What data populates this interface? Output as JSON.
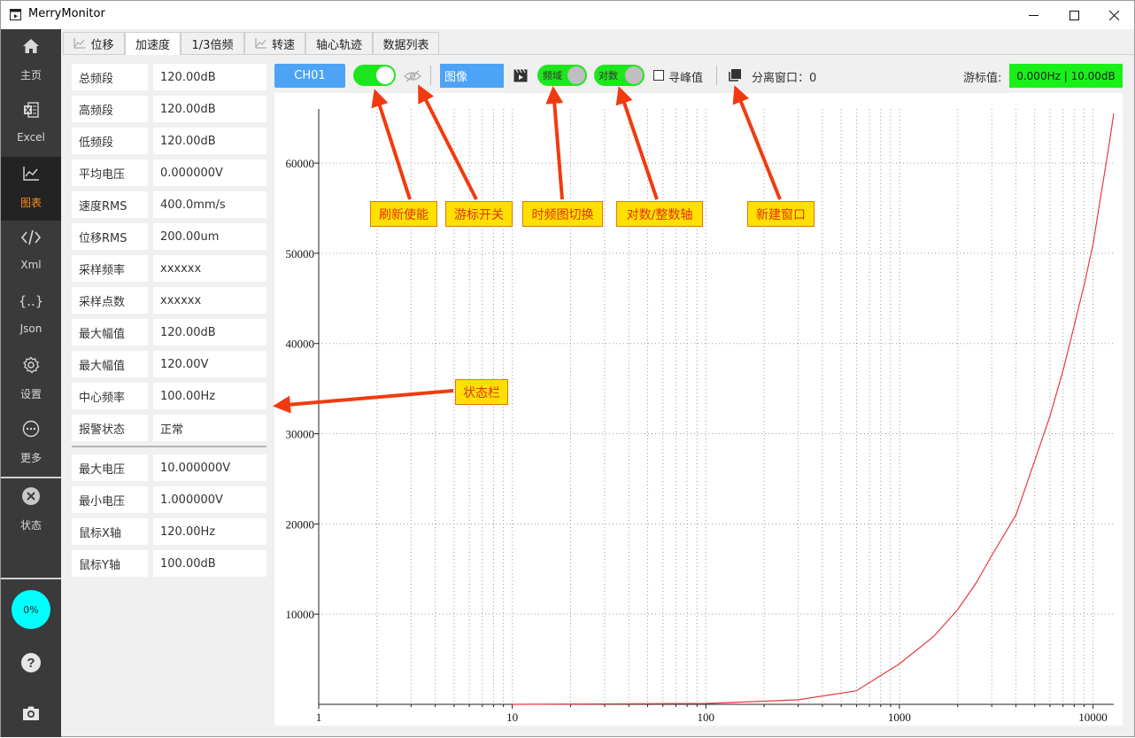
{
  "app": {
    "title": "MerryMonitor"
  },
  "sidebar": {
    "items": [
      {
        "label": "主页",
        "icon": "home-icon"
      },
      {
        "label": "Excel",
        "icon": "excel-icon"
      },
      {
        "label": "图表",
        "icon": "chart-icon",
        "active": true
      },
      {
        "label": "Xml",
        "icon": "code-icon"
      },
      {
        "label": "Json",
        "icon": "braces-icon"
      },
      {
        "label": "设置",
        "icon": "gear-icon"
      },
      {
        "label": "更多",
        "icon": "more-icon"
      },
      {
        "label": "状态",
        "icon": "close-circle-icon"
      }
    ],
    "progress": "0%",
    "progress_value": 0,
    "progress_color": "#00ffff",
    "bottom_icons": [
      "help-icon",
      "camera-icon"
    ]
  },
  "tabs": [
    {
      "label": "位移",
      "icon": "line-chart-icon"
    },
    {
      "label": "加速度",
      "active": true
    },
    {
      "label": "1/3倍频"
    },
    {
      "label": "转速",
      "icon": "line-chart-icon"
    },
    {
      "label": "轴心轨迹"
    },
    {
      "label": "数据列表"
    }
  ],
  "stats": [
    {
      "label": "总频段",
      "value": "120.00dB"
    },
    {
      "label": "高频段",
      "value": "120.00dB"
    },
    {
      "label": "低频段",
      "value": "120.00dB"
    },
    {
      "label": "平均电压",
      "value": "0.000000V"
    },
    {
      "label": "速度RMS",
      "value": "400.0mm/s"
    },
    {
      "label": "位移RMS",
      "value": "200.00um"
    },
    {
      "label": "采样频率",
      "value": "xxxxxx"
    },
    {
      "label": "采样点数",
      "value": "xxxxxx"
    },
    {
      "label": "最大幅值",
      "value": "120.00dB"
    },
    {
      "label": "最大幅值",
      "value": "120.00V"
    },
    {
      "label": "中心频率",
      "value": "100.00Hz"
    },
    {
      "label": "报警状态",
      "value": "正常"
    }
  ],
  "stats2": [
    {
      "label": "最大电压",
      "value": "10.000000V"
    },
    {
      "label": "最小电压",
      "value": "1.000000V"
    },
    {
      "label": "鼠标X轴",
      "value": "120.00Hz"
    },
    {
      "label": "鼠标Y轴",
      "value": "100.00dB"
    }
  ],
  "toolbar": {
    "channel": "CH01",
    "refresh_enabled": true,
    "cursor_visible": false,
    "view_mode": "图像",
    "domain_toggle": "频域",
    "axis_toggle": "对数",
    "peak_label": "寻峰值",
    "peak_checked": false,
    "detach_label": "分离窗口：0",
    "cursor_label": "游标值:",
    "cursor_value": "0.000Hz | 10.00dB",
    "toggle_color": "#1ee61e",
    "button_color": "#4da3f5",
    "cursor_value_color": "#19f019"
  },
  "annotations": [
    {
      "label": "刷新使能"
    },
    {
      "label": "游标开关"
    },
    {
      "label": "时频图切换"
    },
    {
      "label": "对数/整数轴"
    },
    {
      "label": "新建窗口"
    },
    {
      "label": "状态栏"
    }
  ],
  "chart_data": {
    "type": "line",
    "x_scale": "log",
    "xlim": [
      1,
      12800
    ],
    "ylim": [
      0,
      66000
    ],
    "x_ticks": [
      "1",
      "10",
      "100",
      "1000",
      "10000"
    ],
    "y_ticks": [
      "10000",
      "20000",
      "30000",
      "40000",
      "50000",
      "60000"
    ],
    "grid": true,
    "series": [
      {
        "color": "#e8383d",
        "x": [
          10,
          100,
          300,
          600,
          1000,
          1500,
          2000,
          2500,
          3000,
          4000,
          5000,
          6000,
          7000,
          8000,
          9000,
          10000,
          11000,
          12000,
          12800
        ],
        "y": [
          0,
          100,
          500,
          1500,
          4500,
          7500,
          10500,
          13500,
          16500,
          21000,
          27000,
          32000,
          37000,
          42000,
          46500,
          51000,
          56500,
          61500,
          65500
        ]
      }
    ]
  }
}
